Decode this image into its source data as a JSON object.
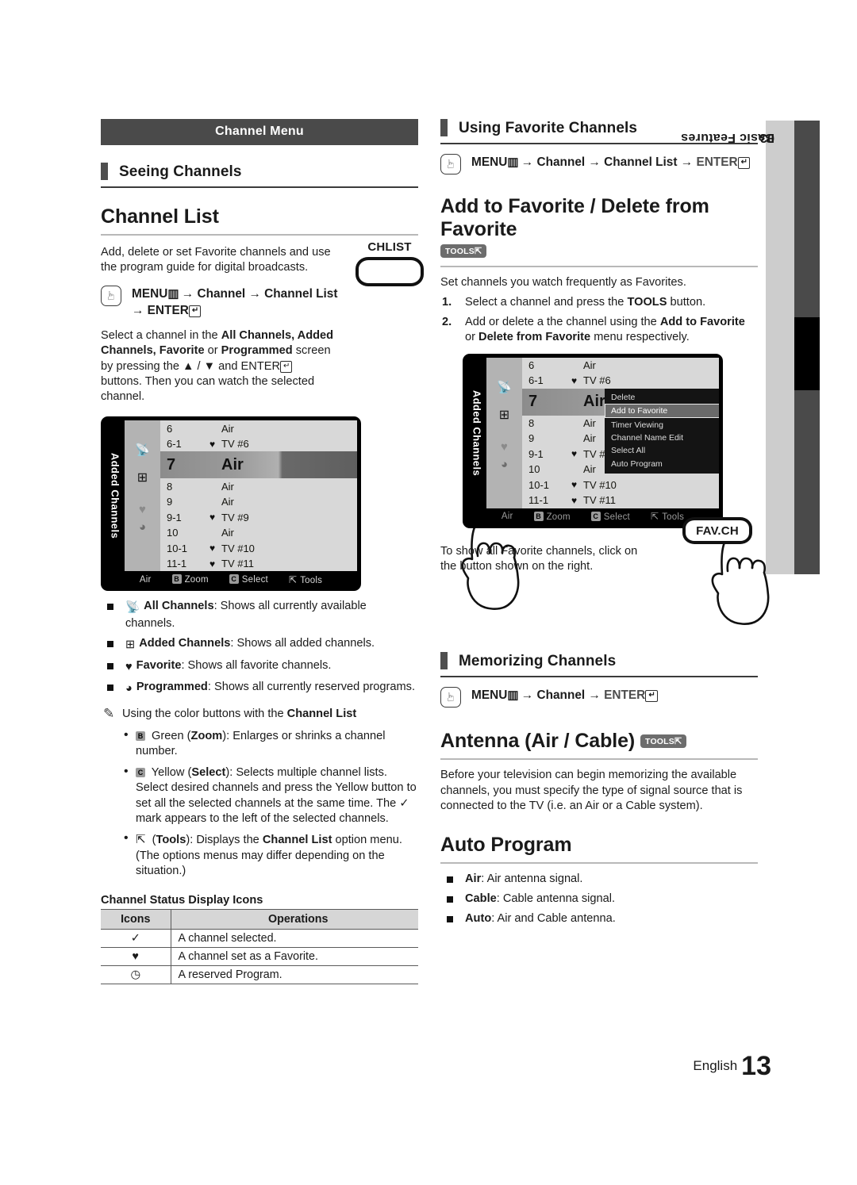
{
  "banner": {
    "title": "Channel Menu"
  },
  "side_tab": {
    "number": "03",
    "label": "Basic Features"
  },
  "footer": {
    "language": "English",
    "page": "13"
  },
  "left": {
    "subhead": "Seeing Channels",
    "heading": "Channel List",
    "intro": "Add, delete or set Favorite channels and use the program guide for digital broadcasts.",
    "menu_path": {
      "menu": "MENU",
      "arrow1": "→",
      "channel": "Channel",
      "arrow2": "→",
      "channel_list": "Channel List",
      "arrow3": "→",
      "enter": "ENTER"
    },
    "remote_button": {
      "label": "CHLIST"
    },
    "paragraph2_parts": {
      "p1": "Select a channel in the ",
      "b1": "All Channels, Added Channels, Favorite",
      "p2": " or ",
      "b2": "Programmed",
      "p3": " screen by pressing the ▲ / ▼ and ",
      "b3": "ENTER",
      "p4": " buttons. Then you can watch the selected channel."
    },
    "list_types": [
      {
        "icon": "all-channels-icon",
        "name": "All Channels",
        "desc": ": Shows all currently available channels."
      },
      {
        "icon": "added-channels-icon",
        "name": "Added Channels",
        "desc": ": Shows all added channels."
      },
      {
        "icon": "heart-icon",
        "name": "Favorite",
        "desc": ": Shows all favorite channels."
      },
      {
        "icon": "clock-icon",
        "name": "Programmed",
        "desc": ": Shows all currently reserved programs."
      }
    ],
    "note_title_pre": "Using the color buttons with the ",
    "note_title_bold": "Channel List",
    "color_buttons": [
      {
        "key": "B",
        "pre": " Green (",
        "bold": "Zoom",
        "post": "): Enlarges or shrinks a channel number."
      },
      {
        "key": "C",
        "pre": " Yellow (",
        "bold": "Select",
        "post": "): Selects multiple channel lists. Select desired channels and press the Yellow button to set all the selected channels at the same time. The ✓ mark appears to the left of the selected channels."
      },
      {
        "key": "TOOLS",
        "pre": " (",
        "bold": "Tools",
        "post": "): Displays the Channel List option menu. (The options menus may differ depending on the situation.)"
      }
    ],
    "tools_bullet": {
      "pre": " (",
      "bold": "Tools",
      "mid": "): Displays the ",
      "bold2": "Channel List",
      "post": " option menu. (The options menus may differ depending on the situation.)"
    },
    "status_table": {
      "title": "Channel Status Display Icons",
      "headers": [
        "Icons",
        "Operations"
      ],
      "rows": [
        {
          "icon": "✓",
          "operation": "A channel selected."
        },
        {
          "icon": "♥",
          "operation": "A channel set as a Favorite."
        },
        {
          "icon": "◷",
          "operation": "A reserved Program."
        }
      ]
    }
  },
  "right": {
    "subhead1": "Using Favorite Channels",
    "menu_path1": {
      "menu": "MENU",
      "channel": "Channel",
      "channel_list": "Channel List",
      "enter": "ENTER"
    },
    "heading1": "Add to Favorite / Delete from Favorite",
    "tools_label": "TOOLS",
    "fav_intro": "Set channels you watch frequently as Favorites.",
    "fav_steps": [
      {
        "p1": "Select a channel and press the ",
        "b1": "TOOLS",
        "p2": " button."
      },
      {
        "p1": "Add or delete a the channel using the ",
        "b1": "Add to Favorite",
        "p2": " or ",
        "b2": "Delete from Favorite",
        "p3": " menu respectively."
      }
    ],
    "fav_hint": "To show all Favorite channels, click on the button shown on the right.",
    "fav_remote": {
      "label": "FAV.CH"
    },
    "subhead2": "Memorizing Channels",
    "menu_path2": {
      "menu": "MENU",
      "channel": "Channel",
      "enter": "ENTER"
    },
    "heading2": "Antenna (Air / Cable)",
    "antenna_text": "Before your television can begin memorizing the available channels, you must specify the type of signal source that is connected to the TV (i.e. an Air or a Cable system).",
    "heading3": "Auto Program",
    "auto_program_items": [
      {
        "name": "Air",
        "desc": ": Air antenna signal."
      },
      {
        "name": "Cable",
        "desc": ": Cable antenna signal."
      },
      {
        "name": "Auto",
        "desc": ": Air and Cable antenna."
      }
    ]
  },
  "tv_screen": {
    "side_label": "Added Channels",
    "rows": [
      {
        "num": "6",
        "fav": "",
        "name": "Air"
      },
      {
        "num": "6-1",
        "fav": "♥",
        "name": "TV #6"
      },
      {
        "num": "7",
        "fav": "",
        "name": "Air",
        "selected": true
      },
      {
        "num": "8",
        "fav": "",
        "name": "Air"
      },
      {
        "num": "9",
        "fav": "",
        "name": "Air"
      },
      {
        "num": "9-1",
        "fav": "♥",
        "name": "TV #9"
      },
      {
        "num": "10",
        "fav": "",
        "name": "Air"
      },
      {
        "num": "10-1",
        "fav": "♥",
        "name": "TV #10"
      },
      {
        "num": "11-1",
        "fav": "♥",
        "name": "TV #11"
      }
    ],
    "bottom_bar": {
      "source": "Air",
      "green_key": "B",
      "green": "Zoom",
      "yellow_key": "C",
      "yellow": "Select",
      "tools": "Tools"
    },
    "popup_menu": [
      "Delete",
      "Add to Favorite",
      "Timer Viewing",
      "Channel Name Edit",
      "Select All",
      "Auto Program"
    ],
    "popup_highlight_index": 1
  }
}
